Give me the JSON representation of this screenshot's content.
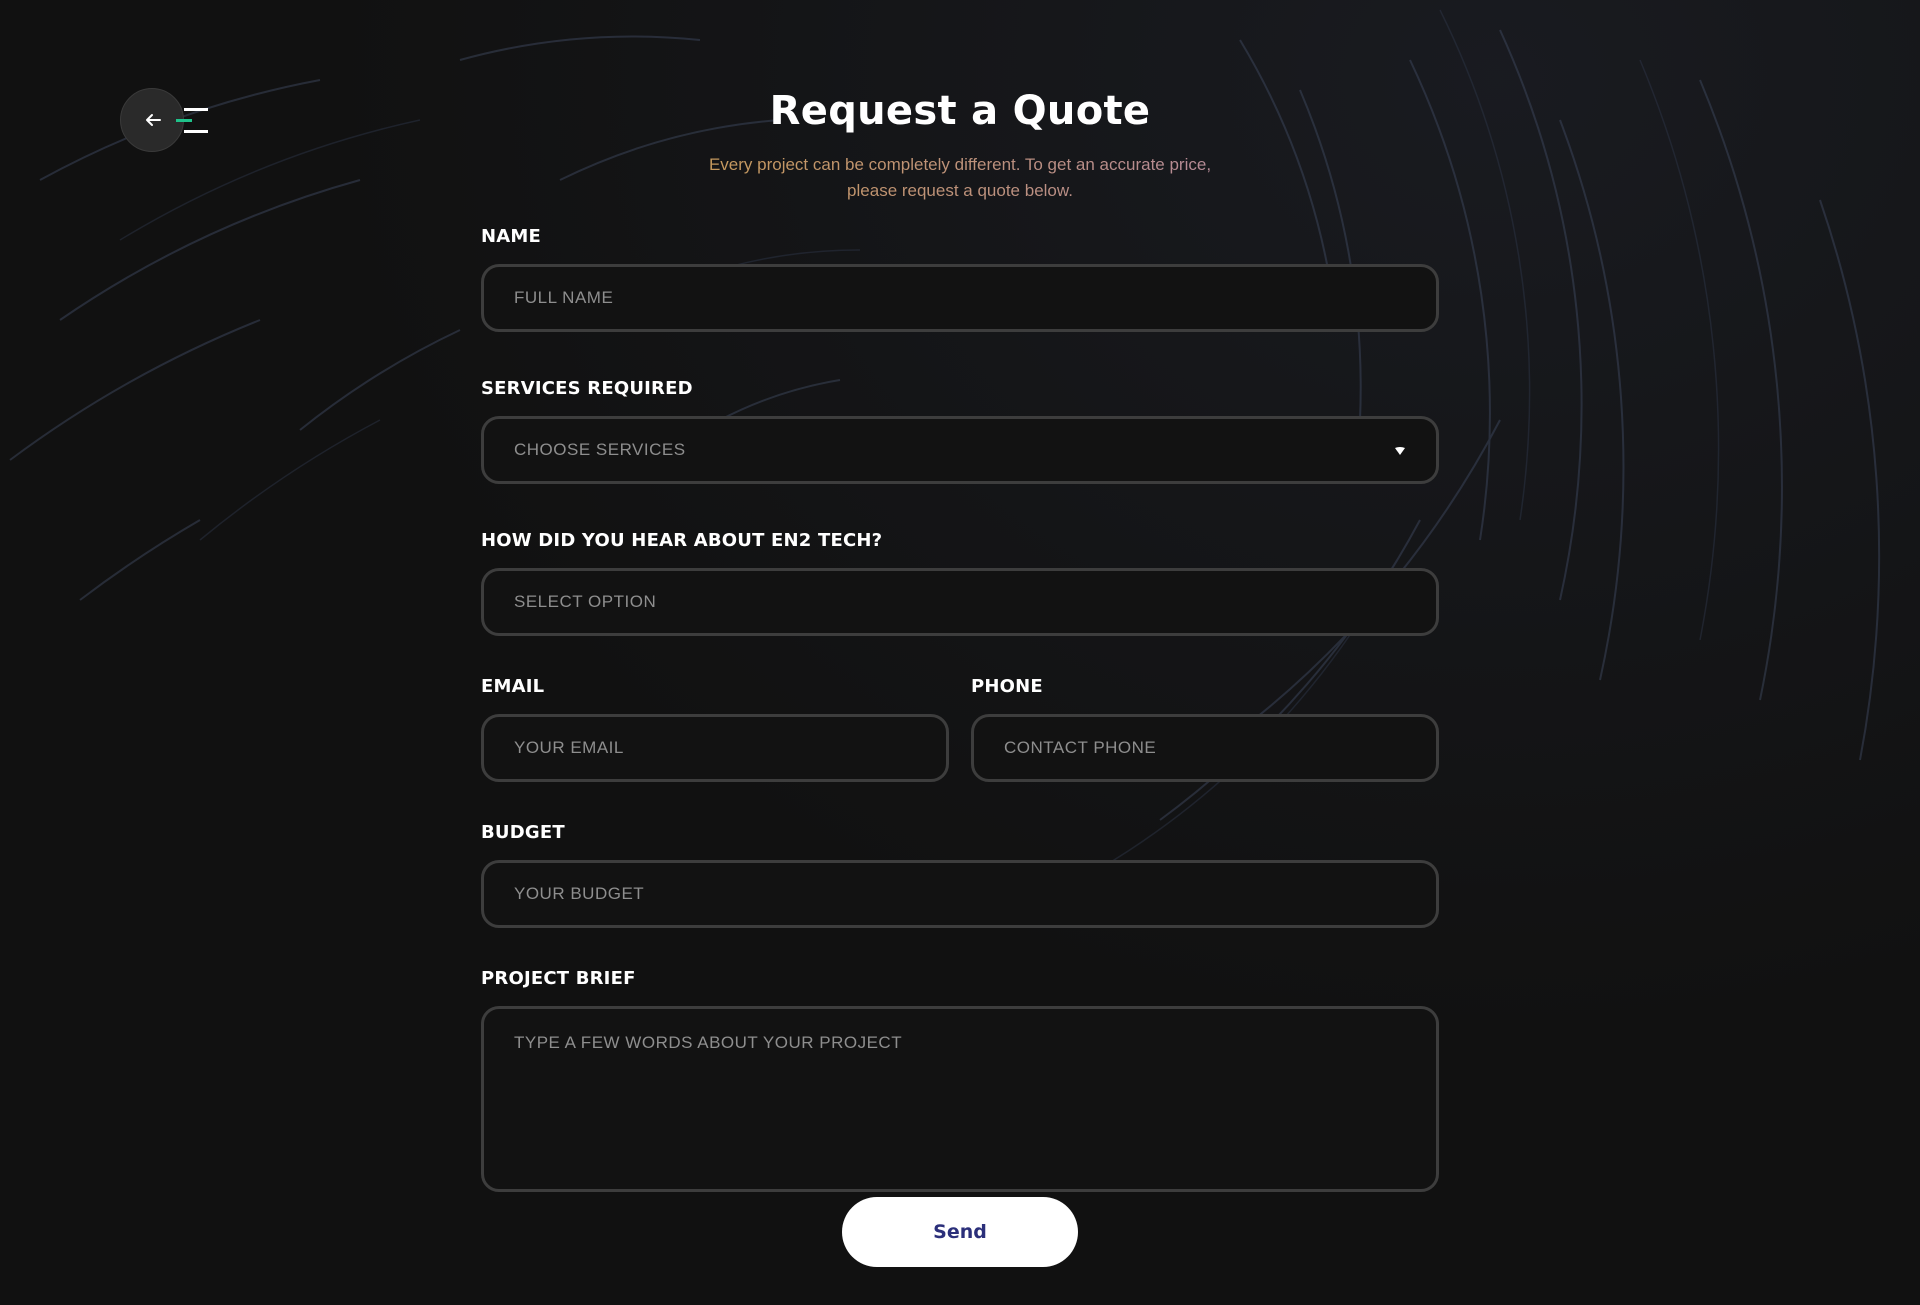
{
  "nav": {
    "back_icon": "arrow-left-icon",
    "menu_icon": "hamburger-menu-icon",
    "accent_color": "#1fc28a"
  },
  "header": {
    "title": "Request a Quote",
    "subtitle_line1": "Every project can be completely different. To get an accurate price,",
    "subtitle_line2": "please request a quote below."
  },
  "form": {
    "name": {
      "label": "NAME",
      "placeholder": "FULL NAME"
    },
    "services": {
      "label": "SERVICES REQUIRED",
      "value": "CHOOSE SERVICES",
      "caret_icon": "caret-down-icon"
    },
    "source": {
      "label": "HOW DID YOU HEAR ABOUT EN2 TECH?",
      "value": "SELECT OPTION"
    },
    "email": {
      "label": "EMAIL",
      "placeholder": "YOUR EMAIL"
    },
    "phone": {
      "label": "PHONE",
      "placeholder": "CONTACT PHONE"
    },
    "budget": {
      "label": "BUDGET",
      "placeholder": "YOUR BUDGET"
    },
    "brief": {
      "label": "PROJECT BRIEF",
      "placeholder": "TYPE A FEW WORDS ABOUT YOUR PROJECT"
    },
    "submit_label": "Send"
  },
  "colors": {
    "background": "#111111",
    "field_border": "#3d3d3d",
    "submit_text": "#2b2f7a"
  }
}
